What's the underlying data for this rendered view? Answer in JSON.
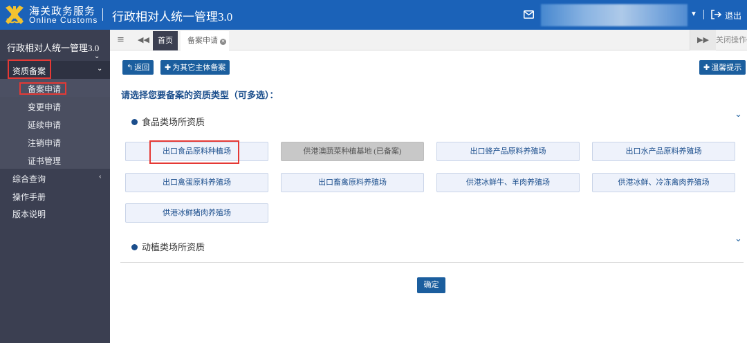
{
  "header": {
    "logo_cn": "海关政务服务",
    "logo_en": "Online Customs",
    "app_title": "行政相对人统一管理3.0",
    "logout_label": "退出"
  },
  "sidebar": {
    "title": "行政相对人统一管理3.0",
    "group": "资质备案",
    "subitems": [
      "备案申请",
      "变更申请",
      "延续申请",
      "注销申请",
      "证书管理"
    ],
    "items": [
      "综合查询",
      "操作手册",
      "版本说明"
    ]
  },
  "tabs": {
    "home": "首页",
    "current": "备案申请",
    "close_ops": "关闭操作"
  },
  "toolbar": {
    "back": "返回",
    "other_entity": "为其它主体备案",
    "tips": "温馨提示"
  },
  "main": {
    "prompt": "请选择您要备案的资质类型（可多选）：",
    "sections": [
      {
        "title": "食品类场所资质",
        "options": [
          {
            "label": "出口食品原料种植场",
            "disabled": false
          },
          {
            "label": "供港澳蔬菜种植基地 (已备案)",
            "disabled": true
          },
          {
            "label": "出口蜂产品原料养殖场",
            "disabled": false
          },
          {
            "label": "出口水产品原料养殖场",
            "disabled": false
          },
          {
            "label": "出口禽蛋原料养殖场",
            "disabled": false
          },
          {
            "label": "出口畜禽原料养殖场",
            "disabled": false
          },
          {
            "label": "供港冰鲜牛、羊肉养殖场",
            "disabled": false
          },
          {
            "label": "供港冰鲜、冷冻禽肉养殖场",
            "disabled": false
          },
          {
            "label": "供港冰鲜猪肉养殖场",
            "disabled": false
          }
        ]
      },
      {
        "title": "动植类场所资质",
        "options": []
      }
    ],
    "confirm": "确定"
  },
  "colors": {
    "header_bg": "#1b62b8",
    "sidebar_bg": "#3b3f51",
    "button_bg": "#1b5e9e",
    "highlight_red": "#e53935"
  }
}
